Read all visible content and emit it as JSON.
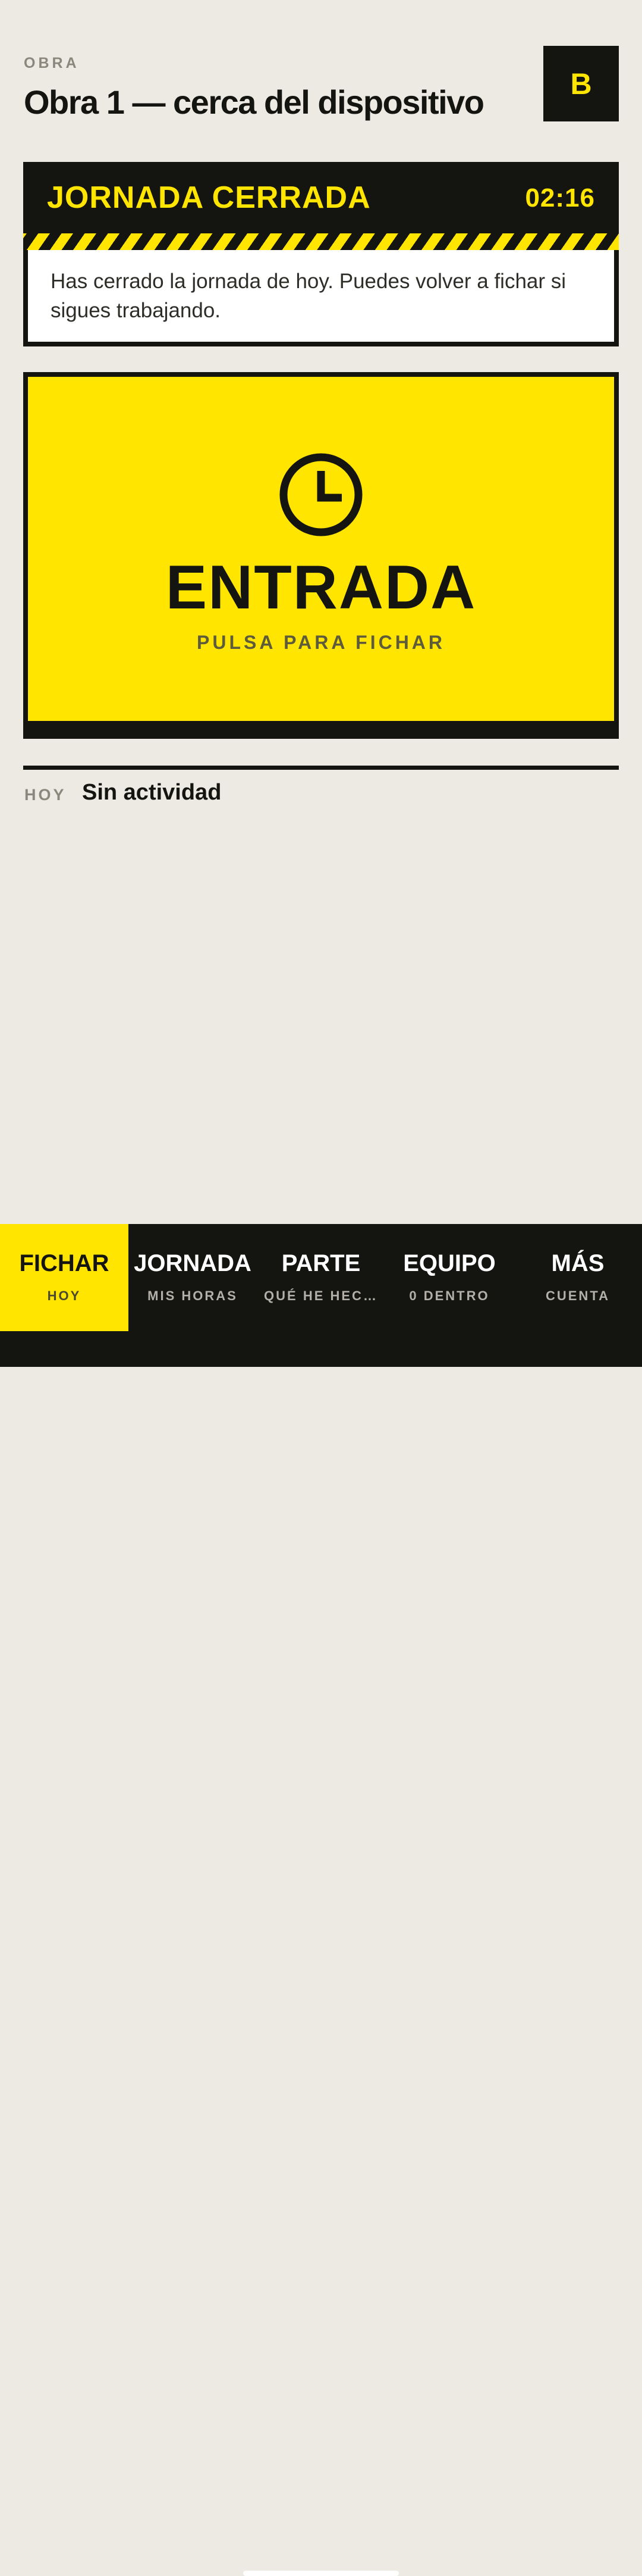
{
  "header": {
    "label": "OBRA",
    "title": "Obra 1 — cerca del dispositivo",
    "avatar_initial": "B"
  },
  "status": {
    "title": "JORNADA CERRADA",
    "time": "02:16",
    "message": "Has cerrado la jornada de hoy. Puedes volver a fichar si sigues trabajando."
  },
  "clock_button": {
    "icon": "clock-icon",
    "label": "ENTRADA",
    "sublabel": "PULSA PARA FICHAR"
  },
  "today": {
    "label": "HOY",
    "value": "Sin actividad"
  },
  "nav": {
    "items": [
      {
        "label": "FICHAR",
        "sub": "HOY",
        "active": true
      },
      {
        "label": "JORNADA",
        "sub": "MIS HORAS",
        "active": false
      },
      {
        "label": "PARTE",
        "sub": "QUÉ HE HEC…",
        "active": false
      },
      {
        "label": "EQUIPO",
        "sub": "0 DENTRO",
        "active": false
      },
      {
        "label": "MÁS",
        "sub": "CUENTA",
        "active": false
      }
    ]
  },
  "colors": {
    "accent": "#ffe500",
    "ink": "#141410",
    "background": "#edeae3"
  }
}
